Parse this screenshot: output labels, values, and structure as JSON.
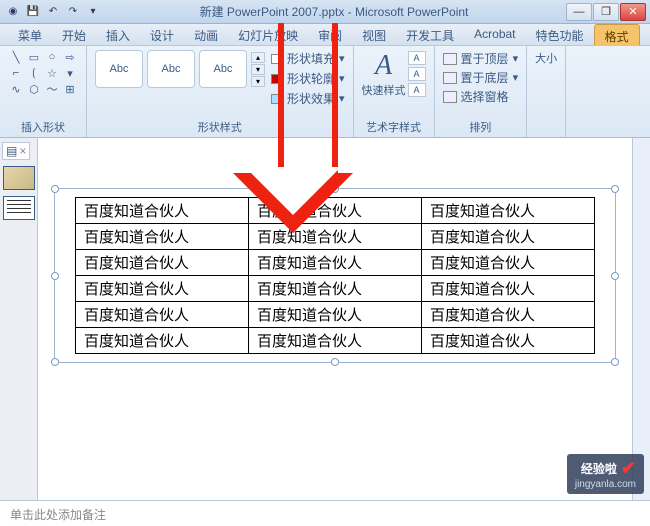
{
  "title": "新建 PowerPoint 2007.pptx - Microsoft PowerPoint",
  "tabs": {
    "t0": "菜单",
    "t1": "开始",
    "t2": "插入",
    "t3": "设计",
    "t4": "动画",
    "t5": "幻灯片放映",
    "t6": "审阅",
    "t7": "视图",
    "t8": "开发工具",
    "t9": "Acrobat",
    "t10": "特色功能",
    "t11": "格式"
  },
  "ribbon": {
    "insert_shape": "插入形状",
    "shape_styles": "形状样式",
    "wordart_styles": "艺术字样式",
    "arrange": "排列",
    "size": "大小",
    "abc": "Abc",
    "shape_fill": "形状填充",
    "shape_outline": "形状轮廓",
    "shape_effects": "形状效果",
    "quick_styles": "快速样式",
    "bring_front": "置于顶层",
    "send_back": "置于底层",
    "selection_pane": "选择窗格"
  },
  "cell_text": "百度知道合伙人",
  "notes_placeholder": "单击此处添加备注",
  "watermark": {
    "brand": "经验啦",
    "url": "jingyanla.com"
  }
}
